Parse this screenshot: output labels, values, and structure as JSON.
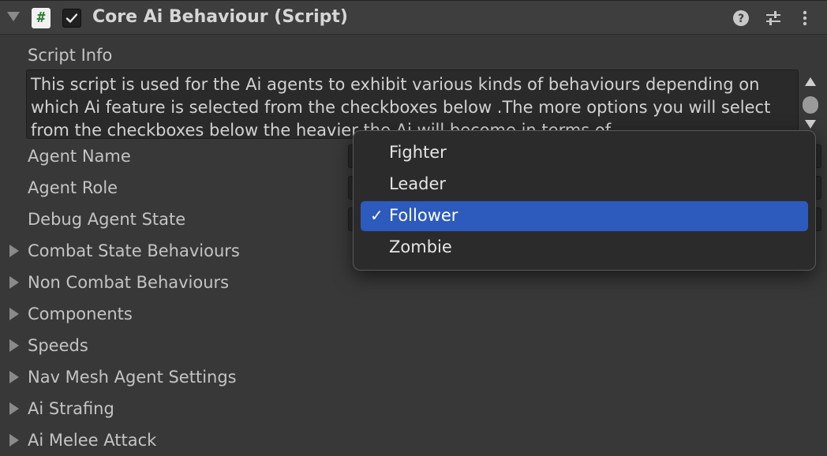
{
  "component": {
    "title": "Core Ai Behaviour (Script)",
    "enabled": true
  },
  "script_info": {
    "label": "Script Info",
    "text": "This script is used for the Ai agents to exhibit various kinds of behaviours depending on which Ai feature is selected from the checkboxes below .The more options you will select from the checkboxes below the heavier the Ai will become in terms of"
  },
  "fields": {
    "agent_name": "Agent Name",
    "agent_role": "Agent Role",
    "debug_agent_state": "Debug Agent State"
  },
  "foldouts": [
    "Combat State Behaviours",
    "Non Combat Behaviours",
    "Components",
    "Speeds",
    "Nav Mesh Agent Settings",
    "Ai Strafing",
    "Ai Melee Attack"
  ],
  "role_dropdown": {
    "options": [
      "Fighter",
      "Leader",
      "Follower",
      "Zombie"
    ],
    "selected": "Follower",
    "check_mark": "✓"
  },
  "icons": {
    "header": [
      "foldout-arrow-icon",
      "script-icon",
      "checkbox-icon",
      "help-icon",
      "preset-icon",
      "more-options-icon"
    ]
  },
  "colors": {
    "background": "#383838",
    "header": "#3e3e3e",
    "selection": "#2c5bbd",
    "script_icon_green": "#2e7d32"
  }
}
